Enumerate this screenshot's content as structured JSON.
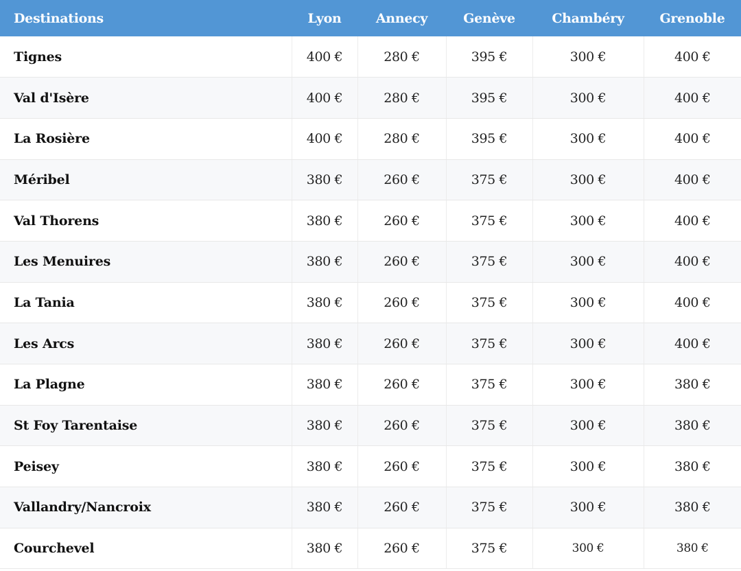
{
  "table": {
    "headers": [
      "Destinations",
      "Lyon",
      "Annecy",
      "Genève",
      "Chambéry",
      "Grenoble"
    ],
    "rows": [
      {
        "destination": "Tignes",
        "prices": [
          "400 €",
          "280 €",
          "395 €",
          "300 €",
          "400 €"
        ]
      },
      {
        "destination": "Val d'Isère",
        "prices": [
          "400 €",
          "280 €",
          "395 €",
          "300 €",
          "400 €"
        ]
      },
      {
        "destination": "La Rosière",
        "prices": [
          "400 €",
          "280 €",
          "395 €",
          "300 €",
          "400 €"
        ]
      },
      {
        "destination": "Méribel",
        "prices": [
          "380 €",
          "260 €",
          "375 €",
          "300 €",
          "400 €"
        ]
      },
      {
        "destination": "Val Thorens",
        "prices": [
          "380 €",
          "260 €",
          "375 €",
          "300 €",
          "400 €"
        ]
      },
      {
        "destination": "Les Menuires",
        "prices": [
          "380 €",
          "260 €",
          "375 €",
          "300 €",
          "400 €"
        ]
      },
      {
        "destination": "La Tania",
        "prices": [
          "380 €",
          "260 €",
          "375 €",
          "300 €",
          "400 €"
        ]
      },
      {
        "destination": "Les Arcs",
        "prices": [
          "380 €",
          "260 €",
          "375 €",
          "300 €",
          "400 €"
        ]
      },
      {
        "destination": "La Plagne",
        "prices": [
          "380 €",
          "260 €",
          "375 €",
          "300 €",
          "380 €"
        ]
      },
      {
        "destination": "St Foy Tarentaise",
        "prices": [
          "380 €",
          "260 €",
          "375 €",
          "300 €",
          "380 €"
        ]
      },
      {
        "destination": "Peisey",
        "prices": [
          "380 €",
          "260 €",
          "375 €",
          "300 €",
          "380 €"
        ]
      },
      {
        "destination": "Vallandry/Nancroix",
        "prices": [
          "380 €",
          "260 €",
          "375 €",
          "300 €",
          "380 €"
        ]
      },
      {
        "destination": "Courchevel",
        "prices": [
          "380 €",
          "260 €",
          "375 €",
          "300 €",
          "380 €"
        ]
      }
    ]
  },
  "colors": {
    "header_bg": "#5296d5",
    "header_text": "#ffffff",
    "row_alt_bg": "#f7f8fa"
  }
}
